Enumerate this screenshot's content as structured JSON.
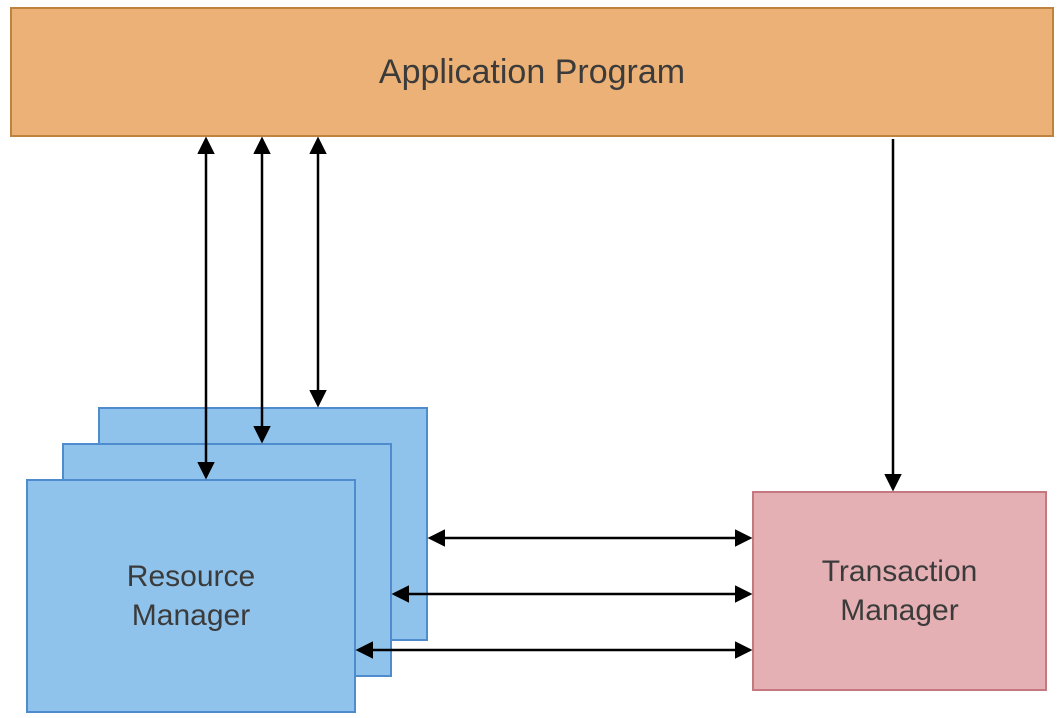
{
  "diagram": {
    "application_program": "Application Program",
    "resource_manager": "Resource\nManager",
    "transaction_manager": "Transaction\nManager"
  },
  "colors": {
    "app_fill": "#ecb176",
    "app_border": "#c0833e",
    "rm_fill": "#8fc3ec",
    "rm_border": "#4e8cce",
    "tm_fill": "#e5b0b4",
    "tm_border": "#c5797e",
    "arrow": "#000000"
  },
  "structure": {
    "nodes": [
      "Application Program",
      "Resource Manager",
      "Transaction Manager"
    ],
    "resource_manager_instances": 3,
    "connections": [
      {
        "from": "Application Program",
        "to": "Resource Manager",
        "direction": "bidirectional",
        "count": 3
      },
      {
        "from": "Application Program",
        "to": "Transaction Manager",
        "direction": "unidirectional"
      },
      {
        "from": "Resource Manager",
        "to": "Transaction Manager",
        "direction": "bidirectional",
        "count": 3
      }
    ]
  }
}
